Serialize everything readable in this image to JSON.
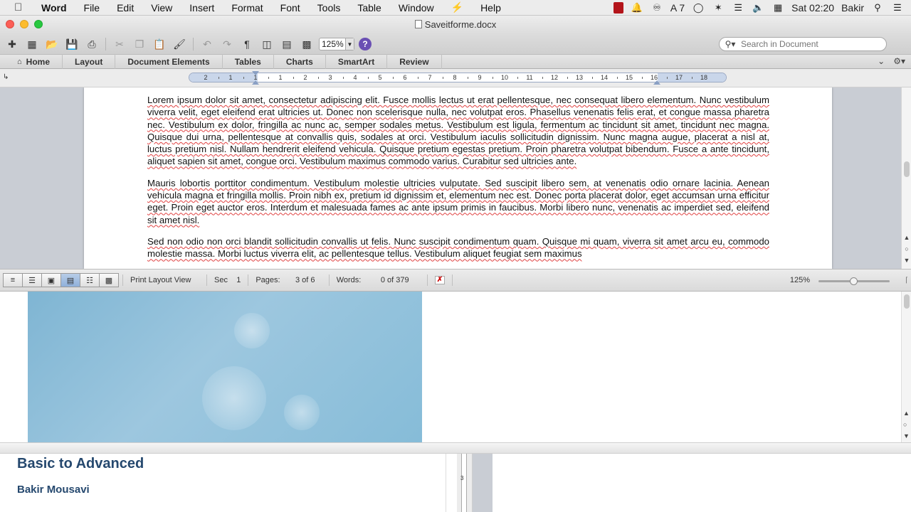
{
  "menubar": {
    "apple": "",
    "app": "Word",
    "items": [
      "File",
      "Edit",
      "View",
      "Insert",
      "Format",
      "Font",
      "Tools",
      "Table",
      "Window",
      "Help"
    ],
    "adobe_count": "7",
    "clock": "Sat 02:20",
    "user": "Bakir"
  },
  "window": {
    "title": "Saveitforme.docx"
  },
  "toolbar": {
    "zoom": "125%",
    "help": "?",
    "search_placeholder": "Search in Document"
  },
  "ribbon": {
    "tabs": [
      "Home",
      "Layout",
      "Document Elements",
      "Tables",
      "Charts",
      "SmartArt",
      "Review"
    ]
  },
  "ruler": {
    "labels": [
      "2",
      "1",
      "1",
      "1",
      "2",
      "3",
      "4",
      "5",
      "6",
      "7",
      "8",
      "9",
      "10",
      "11",
      "12",
      "13",
      "14",
      "15",
      "16",
      "17",
      "18"
    ]
  },
  "document": {
    "paragraphs": [
      "Lorem ipsum dolor sit amet, consectetur adipiscing elit. Fusce mollis lectus ut erat pellentesque, nec consequat libero elementum. Nunc vestibulum viverra velit, eget eleifend erat ultricies ut. Donec non scelerisque nulla, nec volutpat eros. Phasellus venenatis felis erat, et congue massa pharetra nec. Vestibulum ex dolor, fringilla ac nunc ac, semper sodales metus. Vestibulum est ligula, fermentum ac tincidunt sit amet, tincidunt nec magna. Quisque dui urna, pellentesque at convallis quis, sodales at orci. Vestibulum iaculis sollicitudin dignissim. Nunc magna augue, placerat a nisl at, luctus pretium nisl. Nullam hendrerit eleifend vehicula. Quisque pretium egestas pretium. Proin pharetra volutpat bibendum. Fusce a ante tincidunt, aliquet sapien sit amet, congue orci. Vestibulum maximus commodo varius. Curabitur sed ultricies ante.",
      "Mauris lobortis porttitor condimentum. Vestibulum molestie ultricies vulputate. Sed suscipit libero sem, at venenatis odio ornare lacinia. Aenean vehicula magna et fringilla mollis. Proin nibh ex, pretium id dignissim et, elementum nec est. Donec porta placerat dolor, eget accumsan urna efficitur eget. Proin eget auctor eros. Interdum et malesuada fames ac ante ipsum primis in faucibus. Morbi libero nunc, venenatis ac imperdiet sed, eleifend sit amet nisl.",
      "Sed non odio non orci blandit sollicitudin convallis ut felis. Nunc suscipit condimentum quam. Quisque mi quam, viverra sit amet arcu eu, commodo molestie massa. Morbi luctus viverra elit, ac pellentesque tellus. Vestibulum aliquet feugiat sem maximus"
    ]
  },
  "statusbar": {
    "view": "Print Layout View",
    "sec_label": "Sec",
    "sec": "1",
    "pages_label": "Pages:",
    "pages": "3 of 6",
    "words_label": "Words:",
    "words": "0 of 379",
    "zoom": "125%",
    "zoom_slider_fraction": 0.5
  },
  "background_window": {
    "course_title": "Basic to Advanced",
    "author": "Bakir Mousavi",
    "ruler_number": "3"
  },
  "colors": {
    "accent_blue": "#25486e",
    "banner": "#86bcd8",
    "spell_underline": "#e04040"
  }
}
